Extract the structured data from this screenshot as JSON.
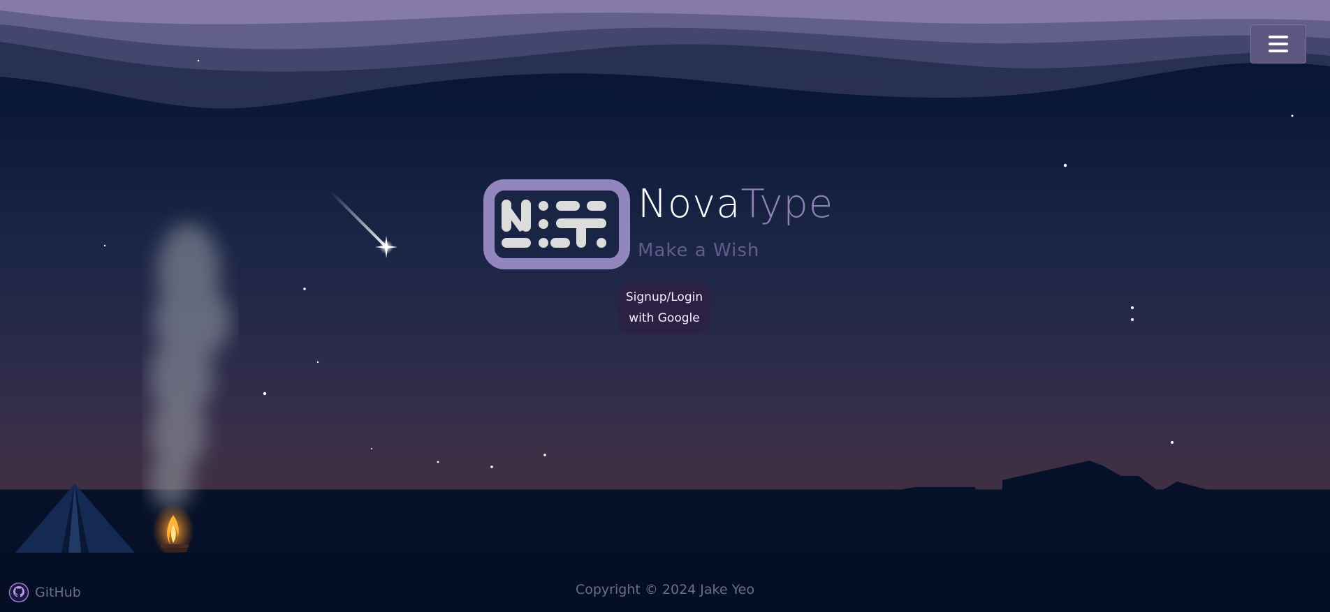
{
  "brand": {
    "name_part1": "Nova",
    "name_part2": "Type",
    "tagline": "Make a Wish",
    "logo_glyphs": "N:T:",
    "colors": {
      "accent": "#9385bd",
      "white": "#ffffff",
      "tagline": "#5f5f8c"
    }
  },
  "auth": {
    "signup_line1": "Signup/Login",
    "signup_line2": "with Google"
  },
  "menu": {
    "icon": "hamburger-menu-icon"
  },
  "footer": {
    "github_label": "GitHub",
    "github_icon": "github-icon",
    "copyright": "Copyright © 2024 Jake Yeo"
  },
  "scene": {
    "description_icons": [
      "shooting-star-icon",
      "tent-icon",
      "campfire-icon",
      "smoke-icon",
      "mountains-silhouette",
      "sky-waves"
    ]
  }
}
